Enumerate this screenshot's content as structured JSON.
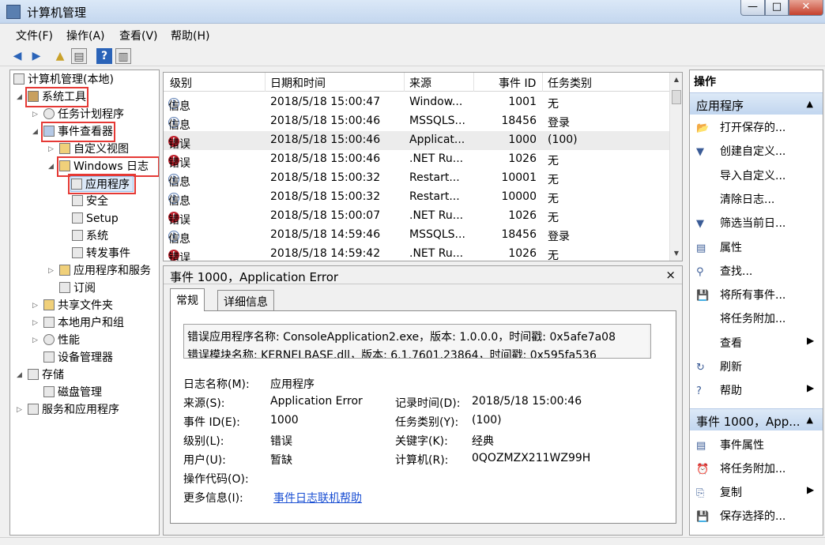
{
  "window": {
    "title": "计算机管理"
  },
  "menu": [
    "文件(F)",
    "操作(A)",
    "查看(V)",
    "帮助(H)"
  ],
  "tree": {
    "root": "计算机管理(本地)",
    "system_tools": "系统工具",
    "task_scheduler": "任务计划程序",
    "event_viewer": "事件查看器",
    "custom_views": "自定义视图",
    "windows_logs": "Windows 日志",
    "application": "应用程序",
    "security": "安全",
    "setup": "Setup",
    "system": "系统",
    "forwarded": "转发事件",
    "apps_services": "应用程序和服务",
    "subscriptions": "订阅",
    "shared_folders": "共享文件夹",
    "local_users": "本地用户和组",
    "performance": "性能",
    "device_manager": "设备管理器",
    "storage": "存储",
    "disk_mgmt": "磁盘管理",
    "services_apps": "服务和应用程序"
  },
  "list": {
    "headers": [
      "级别",
      "日期和时间",
      "来源",
      "事件 ID",
      "任务类别"
    ],
    "rows": [
      {
        "level": "信息",
        "type": "info",
        "date": "2018/5/18 15:00:47",
        "source": "Window...",
        "id": "1001",
        "cat": "无"
      },
      {
        "level": "信息",
        "type": "info",
        "date": "2018/5/18 15:00:46",
        "source": "MSSQLS...",
        "id": "18456",
        "cat": "登录"
      },
      {
        "level": "错误",
        "type": "error",
        "date": "2018/5/18 15:00:46",
        "source": "Applicat...",
        "id": "1000",
        "cat": "(100)"
      },
      {
        "level": "错误",
        "type": "error",
        "date": "2018/5/18 15:00:46",
        "source": ".NET Ru...",
        "id": "1026",
        "cat": "无"
      },
      {
        "level": "信息",
        "type": "info",
        "date": "2018/5/18 15:00:32",
        "source": "Restart...",
        "id": "10001",
        "cat": "无"
      },
      {
        "level": "信息",
        "type": "info",
        "date": "2018/5/18 15:00:32",
        "source": "Restart...",
        "id": "10000",
        "cat": "无"
      },
      {
        "level": "错误",
        "type": "error",
        "date": "2018/5/18 15:00:07",
        "source": ".NET Ru...",
        "id": "1026",
        "cat": "无"
      },
      {
        "level": "信息",
        "type": "info",
        "date": "2018/5/18 14:59:46",
        "source": "MSSQLS...",
        "id": "18456",
        "cat": "登录"
      },
      {
        "level": "错误",
        "type": "error",
        "date": "2018/5/18 14:59:42",
        "source": ".NET Ru...",
        "id": "1026",
        "cat": "无"
      }
    ]
  },
  "detail": {
    "title": "事件 1000，Application Error",
    "tabs": [
      "常规",
      "详细信息"
    ],
    "desc_line1": "错误应用程序名称: ConsoleApplication2.exe，版本: 1.0.0.0，时间戳: 0x5afe7a08",
    "desc_line2": "错误模块名称: KERNELBASE.dll，版本: 6.1.7601.23864，时间戳: 0x595fa536",
    "labels": {
      "log_name": "日志名称(M):",
      "source": "来源(S):",
      "event_id": "事件 ID(E):",
      "level": "级别(L):",
      "user": "用户(U):",
      "opcode": "操作代码(O):",
      "more_info": "更多信息(I):",
      "logged": "记录时间(D):",
      "task_cat": "任务类别(Y):",
      "keywords": "关键字(K):",
      "computer": "计算机(R):"
    },
    "values": {
      "log_name": "应用程序",
      "source": "Application Error",
      "event_id": "1000",
      "level": "错误",
      "user": "暂缺",
      "more_info_link": "事件日志联机帮助",
      "logged": "2018/5/18 15:00:46",
      "task_cat": "(100)",
      "keywords": "经典",
      "computer": "0QOZMZX211WZ99H"
    }
  },
  "actions": {
    "header": "操作",
    "section1": "应用程序",
    "items1": [
      "打开保存的...",
      "创建自定义...",
      "导入自定义...",
      "清除日志...",
      "筛选当前日...",
      "属性",
      "查找...",
      "将所有事件...",
      "将任务附加...",
      "查看",
      "刷新",
      "帮助"
    ],
    "section2": "事件 1000，App...",
    "items2": [
      "事件属性",
      "将任务附加...",
      "复制",
      "保存选择的..."
    ]
  }
}
